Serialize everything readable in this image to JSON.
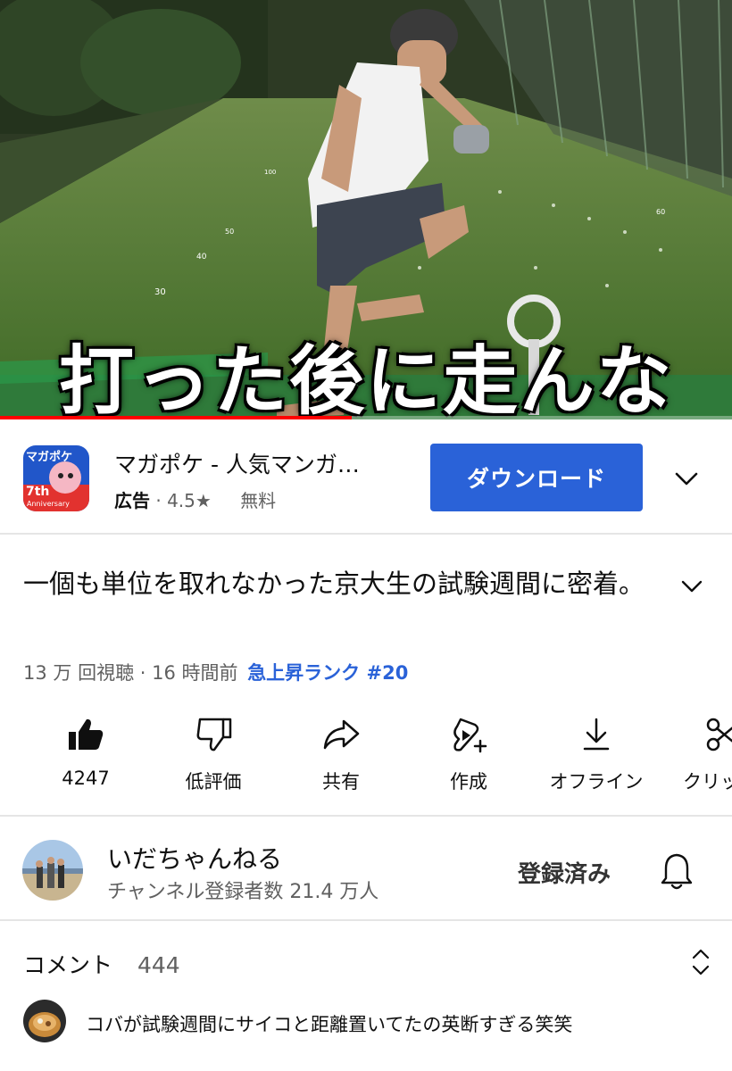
{
  "video": {
    "caption": "打った後に走んな",
    "progress_percent": 48,
    "distance_markers": [
      "30",
      "40",
      "50",
      "100",
      "60"
    ]
  },
  "ad": {
    "app_icon_text": "マガポケ",
    "app_icon_badge": "7th",
    "app_icon_sub": "Anniversary",
    "title": "マガポケ - 人気マンガ…",
    "label": "広告",
    "separator": "·",
    "rating": "4.5★",
    "price": "無料",
    "download_label": "ダウンロード"
  },
  "description": {
    "title": "一個も単位を取れなかった京大生の試験週間に密着。",
    "stats": "13 万 回視聴 · 16 時間前",
    "trend": "急上昇ランク #20"
  },
  "actions": [
    {
      "id": "like",
      "label": "4247",
      "icon": "thumbs-up-icon"
    },
    {
      "id": "dislike",
      "label": "低評価",
      "icon": "thumbs-down-icon"
    },
    {
      "id": "share",
      "label": "共有",
      "icon": "share-icon"
    },
    {
      "id": "create",
      "label": "作成",
      "icon": "create-icon"
    },
    {
      "id": "offline",
      "label": "オフライン",
      "icon": "download-icon"
    },
    {
      "id": "clip",
      "label": "クリッ",
      "icon": "scissors-icon"
    }
  ],
  "channel": {
    "name": "いだちゃんねる",
    "subscribers": "チャンネル登録者数 21.4 万人",
    "subscribed_label": "登録済み"
  },
  "comments": {
    "label": "コメント",
    "count": "444",
    "top_comment": "コバが試験週間にサイコと距離置いてたの英断すぎる笑笑"
  },
  "colors": {
    "accent_blue": "#2a62d8",
    "progress_red": "#ff0000",
    "text_primary": "#0f0f0f",
    "text_secondary": "#606060"
  }
}
